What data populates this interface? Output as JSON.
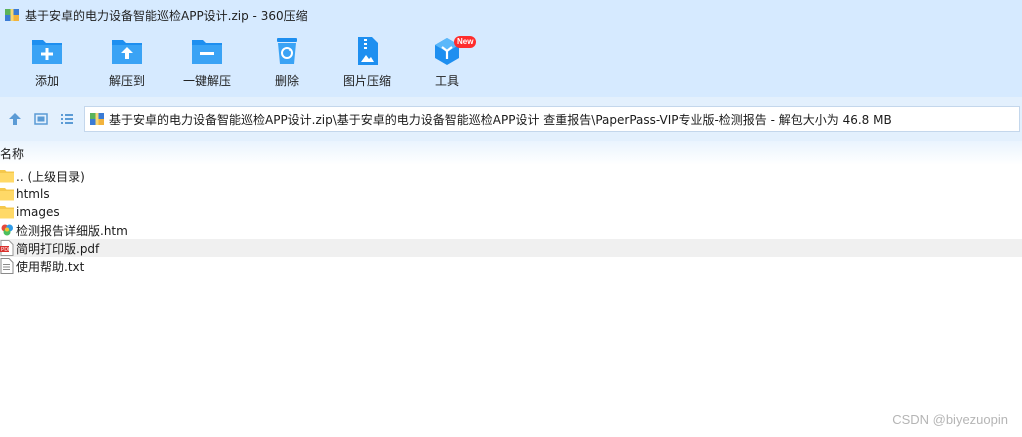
{
  "window": {
    "title": "基于安卓的电力设备智能巡检APP设计.zip - 360压缩"
  },
  "toolbar": {
    "items": [
      {
        "label": "添加",
        "icon": "add-folder-icon"
      },
      {
        "label": "解压到",
        "icon": "extract-to-folder-icon"
      },
      {
        "label": "一键解压",
        "icon": "one-click-extract-icon"
      },
      {
        "label": "删除",
        "icon": "recycle-bin-icon"
      },
      {
        "label": "图片压缩",
        "icon": "image-compress-icon"
      },
      {
        "label": "工具",
        "icon": "tools-cube-icon",
        "badge": "New"
      }
    ],
    "accent": "#1e8ff0"
  },
  "address": {
    "path": "基于安卓的电力设备智能巡检APP设计.zip\\基于安卓的电力设备智能巡检APP设计 查重报告\\PaperPass-VIP专业版-检测报告 - 解包大小为 46.8 MB"
  },
  "list": {
    "column_name": "名称",
    "rows": [
      {
        "name": ".. (上级目录)",
        "icon": "folder-icon"
      },
      {
        "name": "htmls",
        "icon": "folder-icon"
      },
      {
        "name": "images",
        "icon": "folder-icon"
      },
      {
        "name": "检测报告详细版.htm",
        "icon": "html-file-icon"
      },
      {
        "name": "简明打印版.pdf",
        "icon": "pdf-file-icon"
      },
      {
        "name": "使用帮助.txt",
        "icon": "text-file-icon"
      }
    ]
  },
  "watermark": "CSDN @biyezuopin"
}
